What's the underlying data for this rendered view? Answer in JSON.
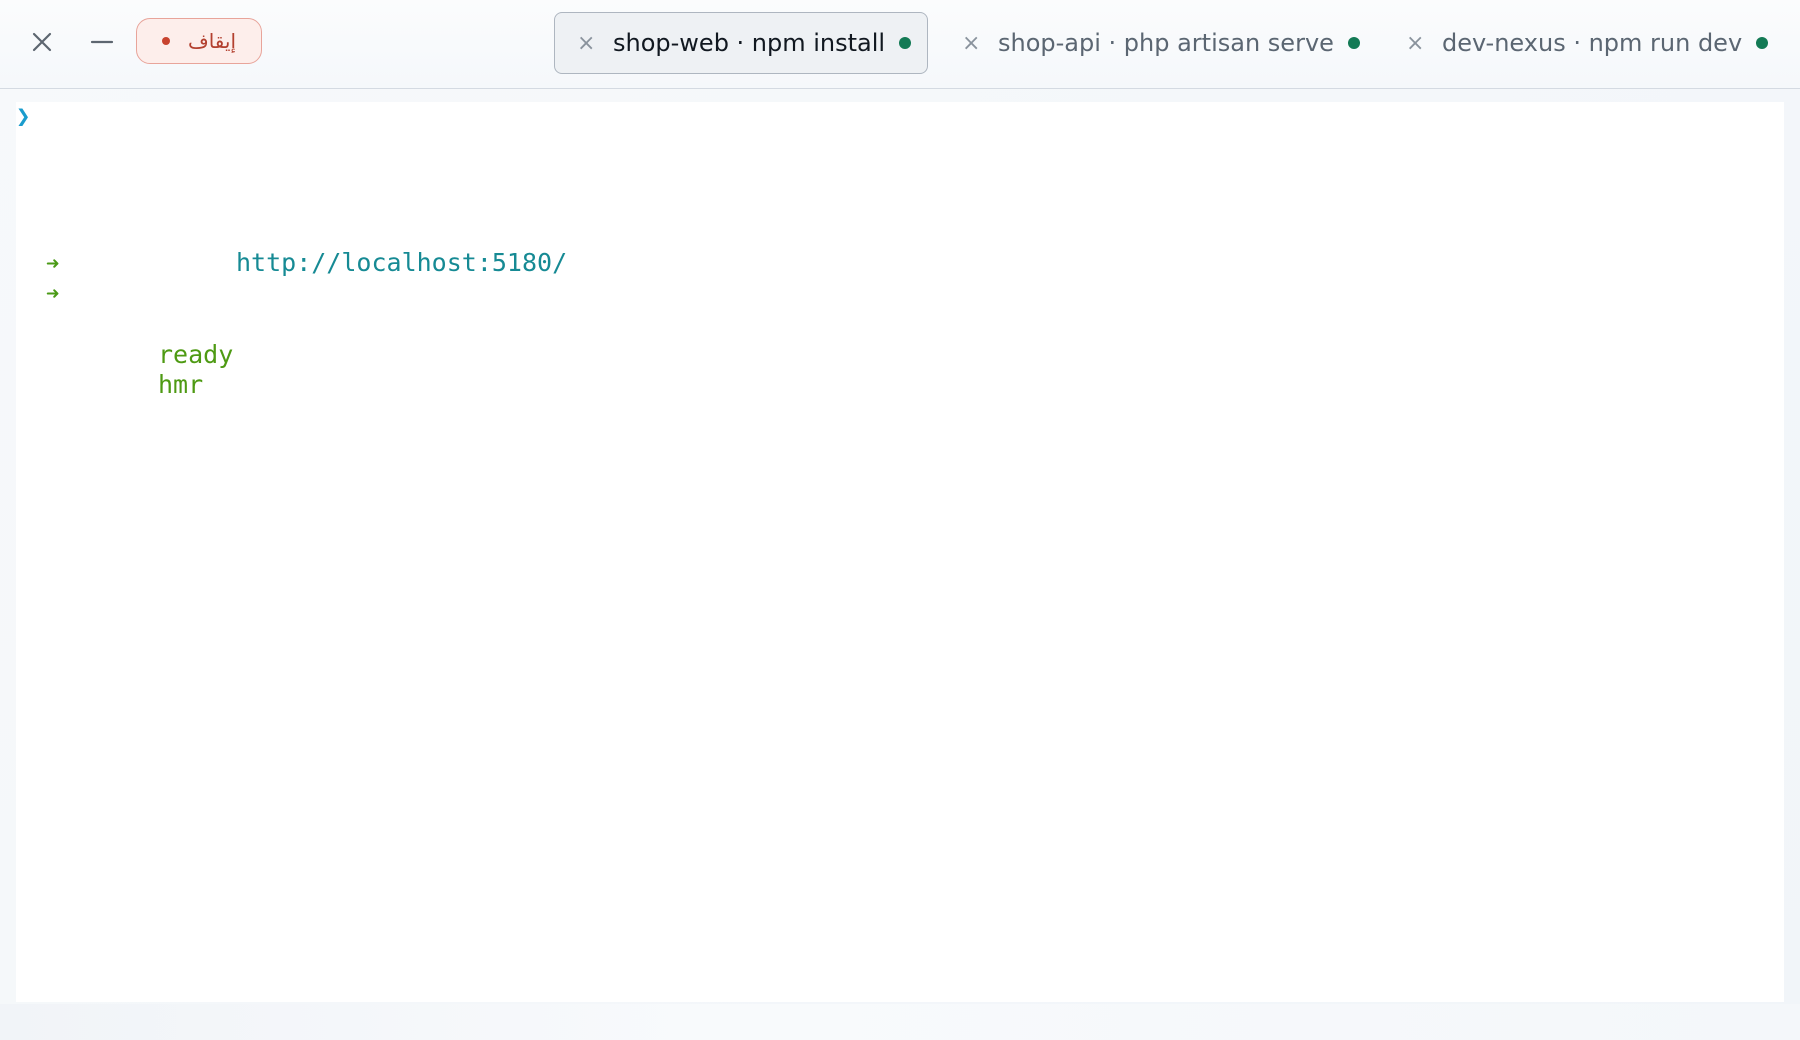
{
  "window_controls": {
    "close_icon": "close-icon",
    "minimize_icon": "minimize-icon",
    "stop_button_label": "إيقاف",
    "stop_color": "#b3402f"
  },
  "tabs": [
    {
      "label": "shop-web · npm install",
      "active": true,
      "status": "running"
    },
    {
      "label": "shop-api · php artisan serve",
      "active": false,
      "status": "running"
    },
    {
      "label": "dev-nexus · npm run dev",
      "active": false,
      "status": "running"
    }
  ],
  "terminal": {
    "prompt_symbol": "❯",
    "arrow_symbol": "➜",
    "url": "http://localhost:5180/",
    "status_words": [
      "ready",
      "hmr"
    ]
  },
  "colors": {
    "status_running": "#137a55",
    "prompt": "#1a9ccd",
    "url": "#168a94",
    "ready_text": "#4e9a13"
  }
}
